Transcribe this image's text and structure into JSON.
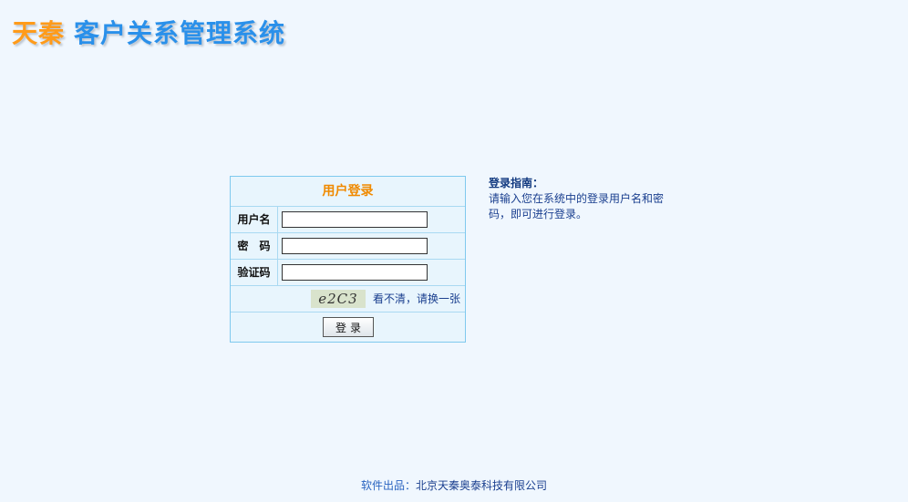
{
  "logo": {
    "brand": "天秦",
    "system_name": "客户关系管理系统"
  },
  "login": {
    "title": "用户登录",
    "username_label": "用户名",
    "username_value": "",
    "password_label": "密　码",
    "password_value": "",
    "captcha_label": "验证码",
    "captcha_value": "",
    "captcha_image_text": "e2C3",
    "refresh_link": "看不清，请换一张",
    "submit_label": "登录"
  },
  "guide": {
    "title": "登录指南：",
    "text": "请输入您在系统中的登录用户名和密码，即可进行登录。"
  },
  "footer": {
    "label": "软件出品：",
    "company": "北京天秦奥泰科技有限公司"
  },
  "colors": {
    "background": "#f0f7fe",
    "brand_orange": "#ff9b1a",
    "brand_blue": "#2a90ea",
    "title_orange": "#f08a00",
    "border_blue": "#7fc9ee",
    "link_blue": "#1a3f8f"
  }
}
